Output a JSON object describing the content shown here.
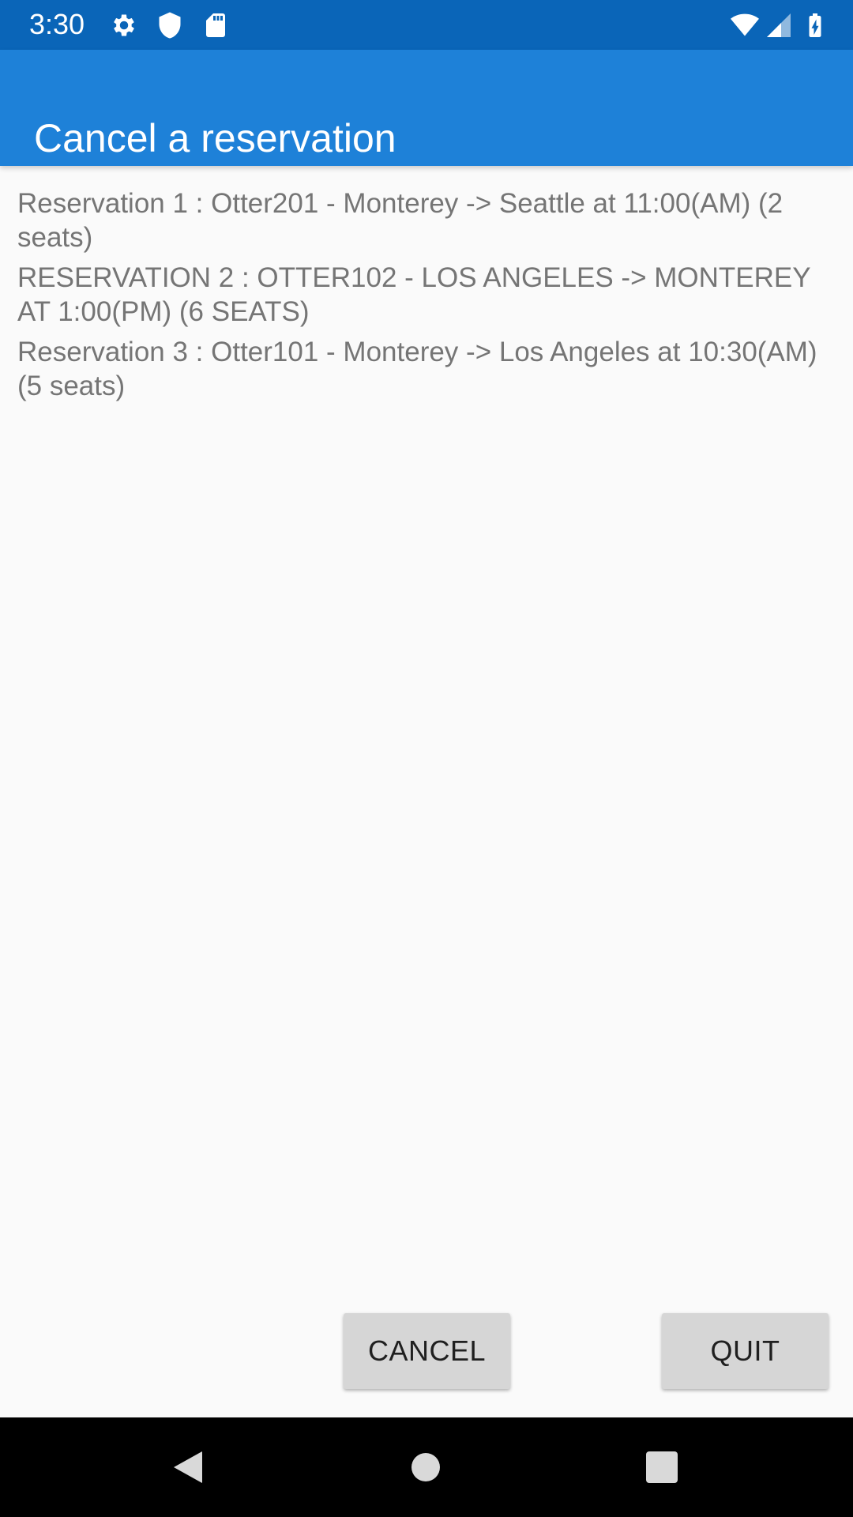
{
  "status_bar": {
    "time": "3:30",
    "left_icons": [
      "gear-icon",
      "shield-icon",
      "sd-card-icon"
    ],
    "right_icons": [
      "wifi-icon",
      "signal-icon",
      "battery-charging-icon"
    ],
    "color": "#0a65b8"
  },
  "app_bar": {
    "title": "Cancel a reservation",
    "color": "#1e81d8"
  },
  "reservations": [
    {
      "text": "Reservation 1 : Otter201 - Monterey -> Seattle at 11:00(AM) (2 seats)"
    },
    {
      "text": "RESERVATION 2 : OTTER102 - LOS ANGELES -> MONTEREY AT 1:00(PM) (6 SEATS)"
    },
    {
      "text": "Reservation 3 : Otter101 - Monterey -> Los Angeles at 10:30(AM) (5 seats)"
    }
  ],
  "buttons": {
    "cancel_label": "CANCEL",
    "quit_label": "QUIT"
  },
  "nav_bar": {
    "buttons": [
      "back-icon",
      "home-icon",
      "recents-icon"
    ]
  }
}
